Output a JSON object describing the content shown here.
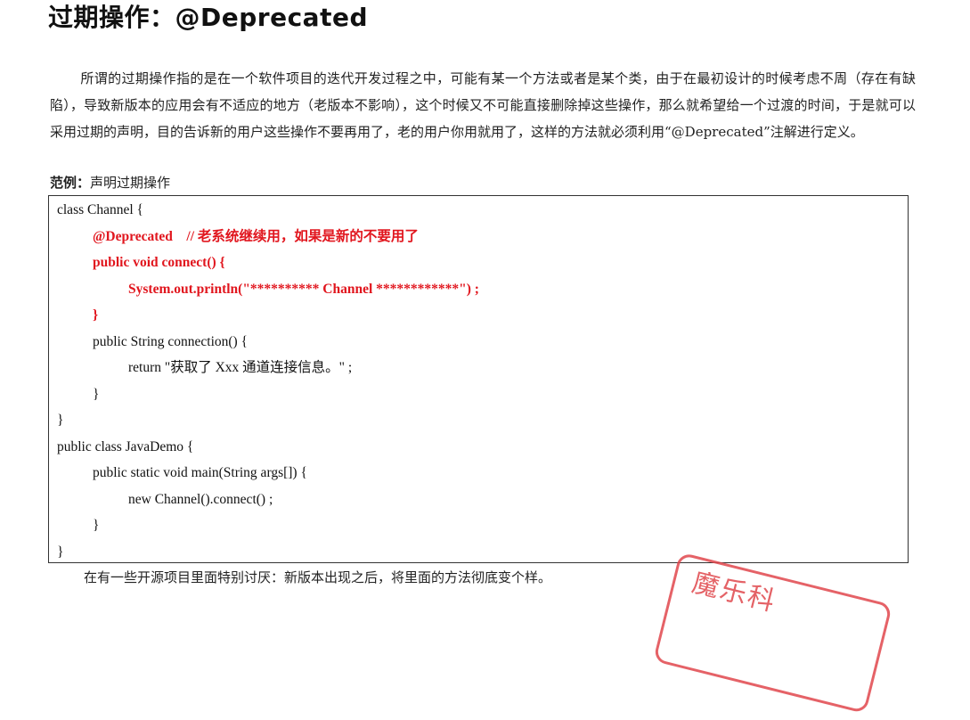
{
  "document": {
    "title": "过期操作：@Deprecated",
    "paragraph1": "所谓的过期操作指的是在一个软件项目的迭代开发过程之中，可能有某一个方法或者是某个类，由于在最初设计的时候考虑不周（存在有缺陷），导致新版本的应用会有不适应的地方（老版本不影响），这个时候又不可能直接删除掉这些操作，那么就希望给一个过渡的时间，于是就可以采用过期的声明，目的告诉新的用户这些操作不要再用了，老的用户你用就用了，这样的方法就必须利用“@Deprecated”注解进行定义。",
    "example_label": "范例：",
    "example_caption": "声明过期操作",
    "code_lines": [
      "class Channel {",
      "@Deprecated    // 老系统继续用，如果是新的不要用了",
      "public void connect() {",
      "System.out.println(\"********** Channel ************\") ;",
      "}",
      "public String connection() {",
      "return \"获取了 Xxx 通道连接信息。\" ;",
      "}",
      "}",
      "public class JavaDemo {",
      "public static void main(String args[]) {",
      "new Channel().connect() ;",
      "}",
      "}"
    ],
    "paragraph2": "在有一些开源项目里面特别讨厌：新版本出现之后，将里面的方法彻底变个样。"
  },
  "stamp": {
    "text": "魔乐科",
    "color": "#e0474c"
  },
  "colors": {
    "highlight_red": "#e1161e"
  }
}
